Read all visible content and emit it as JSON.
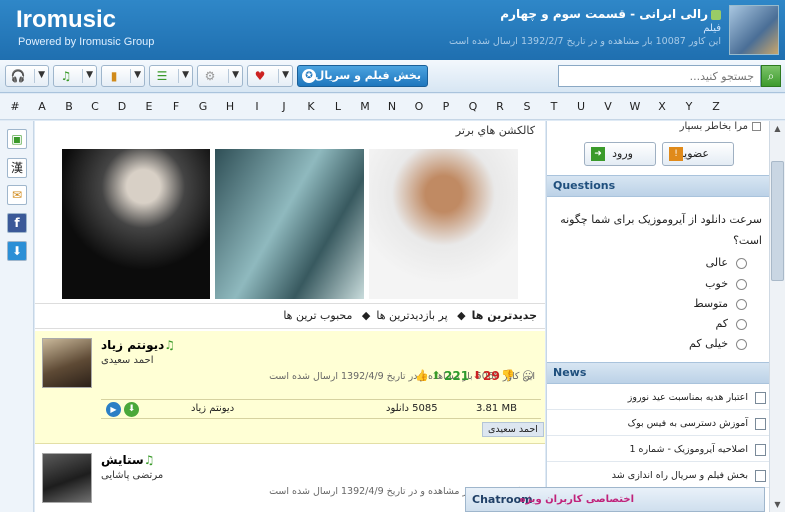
{
  "header": {
    "logo": "Iromusic",
    "tagline": "Powered by Iromusic Group",
    "featured": {
      "title": "رالی ایرانی - قسمت سوم و چهارم",
      "category": "فیلم",
      "meta": "این کاور 10087 بار مشاهده و در تاریخ 1392/2/7 ارسال شده است"
    }
  },
  "toolbar": {
    "movies_label": "بخش فیلم و سریال",
    "search_placeholder": "جستجو کنید..."
  },
  "alphabet": [
    "#",
    "A",
    "B",
    "C",
    "D",
    "E",
    "F",
    "G",
    "H",
    "I",
    "J",
    "K",
    "L",
    "M",
    "N",
    "O",
    "P",
    "Q",
    "R",
    "S",
    "T",
    "U",
    "V",
    "W",
    "X",
    "Y",
    "Z"
  ],
  "left_icons": [
    "new-icon",
    "chinese-char-icon",
    "mail-icon",
    "facebook-icon",
    "download-icon"
  ],
  "main": {
    "collections_title": "کالکشن هاي برتر",
    "tabs": [
      "جدیدترین ها",
      "پر بازدیدترین ها",
      "محبوب ترین ها"
    ],
    "tab_sep": "◆",
    "items": [
      {
        "title": "دیونتم زیاد",
        "artist": "احمد سعیدی",
        "meta": "این کاور 5060 بار مشاهده و در تاریخ 1392/4/9 ارسال شده است",
        "likes": "221",
        "dislikes": "29",
        "track_name": "دیونتم زیاد",
        "downloads": "5085 دانلود",
        "size": "3.81 MB",
        "artist_tag": "احمد سعیدی"
      },
      {
        "title": "ستایش",
        "artist": "مرتضی پاشایی",
        "meta": "این کاور 6256 بار مشاهده و در تاریخ 1392/4/9 ارسال شده است"
      }
    ]
  },
  "right": {
    "remember_me": "مرا بخاطر بسپار",
    "login": "ورود",
    "register": "عضویت",
    "questions_title": "Questions",
    "poll_question": "سرعت دانلود از آیروموزیک برای شما چگونه است؟",
    "poll_options": [
      "عالی",
      "خوب",
      "متوسط",
      "کم",
      "خیلی کم"
    ],
    "news_title": "News",
    "news": [
      "اعتبار هدیه بمناسبت عید نوروز",
      "آموزش دسترسی به فیس بوک",
      "اصلاحیه آیروموزیک - شماره 1",
      "بخش فیلم و سریال راه اندازی شد"
    ],
    "chatroom_title": "Chatroom",
    "chatroom_sub": "اختصاصی کاربران ویژه"
  },
  "colors": {
    "header_blue": "#1f6fb0",
    "accent_green": "#2d9a2d",
    "accent_red": "#cc2222",
    "highlight_yellow": "#ffffd5"
  }
}
